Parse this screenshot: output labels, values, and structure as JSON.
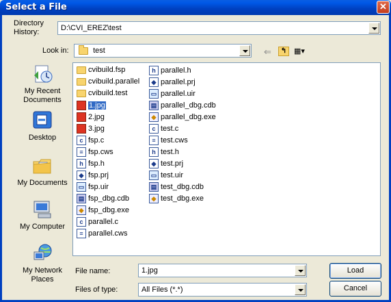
{
  "window": {
    "title": "Select a File",
    "close_glyph": "✕"
  },
  "directory_history": {
    "label": "Directory History:",
    "label_line1": "Directory",
    "label_line2": "History:",
    "value": "D:\\CVI_EREZ\\test"
  },
  "look_in": {
    "label": "Look in:",
    "value": "test"
  },
  "toolbar": {
    "back_glyph": "⇐",
    "up_glyph": "↰",
    "view_glyph": "▦▾"
  },
  "places": [
    {
      "label_line1": "My Recent",
      "label_line2": "Documents",
      "icon": "recent-documents-icon"
    },
    {
      "label_line1": "Desktop",
      "label_line2": "",
      "icon": "desktop-icon"
    },
    {
      "label_line1": "My Documents",
      "label_line2": "",
      "icon": "my-documents-icon"
    },
    {
      "label_line1": "My Computer",
      "label_line2": "",
      "icon": "my-computer-icon"
    },
    {
      "label_line1": "My Network",
      "label_line2": "Places",
      "icon": "network-places-icon"
    }
  ],
  "files_col1": [
    {
      "name": "cvibuild.fsp",
      "type": "folder",
      "glyph": ""
    },
    {
      "name": "cvibuild.parallel",
      "type": "folder",
      "glyph": ""
    },
    {
      "name": "cvibuild.test",
      "type": "folder",
      "glyph": ""
    },
    {
      "name": "1.jpg",
      "type": "jpg",
      "glyph": "",
      "selected": true
    },
    {
      "name": "2.jpg",
      "type": "jpg",
      "glyph": ""
    },
    {
      "name": "3.jpg",
      "type": "jpg",
      "glyph": ""
    },
    {
      "name": "fsp.c",
      "type": "c",
      "glyph": "c"
    },
    {
      "name": "fsp.cws",
      "type": "cws",
      "glyph": "≡"
    },
    {
      "name": "fsp.h",
      "type": "h",
      "glyph": "h"
    },
    {
      "name": "fsp.prj",
      "type": "prj",
      "glyph": "◆"
    },
    {
      "name": "fsp.uir",
      "type": "uir",
      "glyph": "▭"
    },
    {
      "name": "fsp_dbg.cdb",
      "type": "cdb",
      "glyph": "▤"
    },
    {
      "name": "fsp_dbg.exe",
      "type": "exe",
      "glyph": "◆"
    },
    {
      "name": "parallel.c",
      "type": "c",
      "glyph": "c"
    },
    {
      "name": "parallel.cws",
      "type": "cws",
      "glyph": "≡"
    }
  ],
  "files_col2": [
    {
      "name": "parallel.h",
      "type": "h",
      "glyph": "h"
    },
    {
      "name": "parallel.prj",
      "type": "prj",
      "glyph": "◆"
    },
    {
      "name": "parallel.uir",
      "type": "uir",
      "glyph": "▭"
    },
    {
      "name": "parallel_dbg.cdb",
      "type": "cdb",
      "glyph": "▤"
    },
    {
      "name": "parallel_dbg.exe",
      "type": "exe",
      "glyph": "◆"
    },
    {
      "name": "test.c",
      "type": "c",
      "glyph": "c"
    },
    {
      "name": "test.cws",
      "type": "cws",
      "glyph": "≡"
    },
    {
      "name": "test.h",
      "type": "h",
      "glyph": "h"
    },
    {
      "name": "test.prj",
      "type": "prj",
      "glyph": "◆"
    },
    {
      "name": "test.uir",
      "type": "uir",
      "glyph": "▭"
    },
    {
      "name": "test_dbg.cdb",
      "type": "cdb",
      "glyph": "▤"
    },
    {
      "name": "test_dbg.exe",
      "type": "exe",
      "glyph": "◆"
    }
  ],
  "file_name": {
    "label": "File name:",
    "value": "1.jpg"
  },
  "file_type": {
    "label": "Files of type:",
    "value": "All Files (*.*)"
  },
  "buttons": {
    "load": "Load",
    "cancel": "Cancel"
  },
  "colors": {
    "title_bar": "#0040c0",
    "selection": "#316ac5",
    "dialog_bg": "#ece9d8"
  }
}
